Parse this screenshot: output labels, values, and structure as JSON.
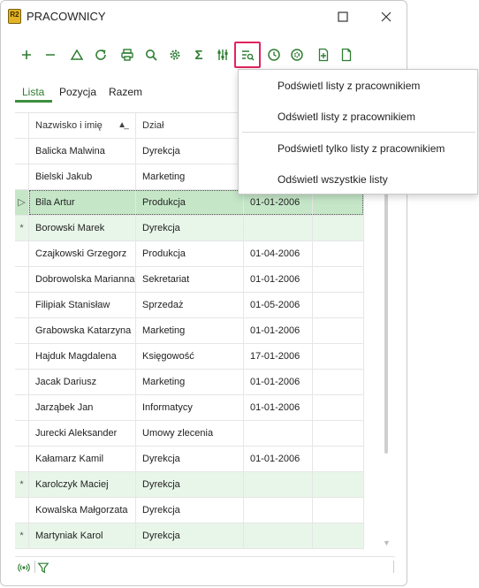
{
  "window": {
    "title": "PRACOWNICY",
    "logo_text": "R2",
    "maximize_icon": "square-icon",
    "close_icon": "close-icon"
  },
  "toolbar": {
    "buttons": [
      {
        "name": "add",
        "icon": "plus-icon"
      },
      {
        "name": "remove",
        "icon": "minus-icon"
      },
      {
        "name": "up",
        "icon": "triangle-icon"
      },
      {
        "name": "refresh",
        "icon": "refresh-icon"
      },
      {
        "name": "print",
        "icon": "printer-icon"
      },
      {
        "name": "search",
        "icon": "magnifier-icon"
      },
      {
        "name": "settings",
        "icon": "gear-icon"
      },
      {
        "name": "sum",
        "icon": "sigma-icon",
        "glyph": "Σ"
      },
      {
        "name": "filters",
        "icon": "sliders-icon"
      },
      {
        "name": "highlight-list",
        "icon": "list-search-icon",
        "active": true
      },
      {
        "name": "history",
        "icon": "clock-icon"
      },
      {
        "name": "config",
        "icon": "cog-badge-icon"
      },
      {
        "name": "new-document",
        "icon": "doc-plus-icon"
      },
      {
        "name": "document",
        "icon": "document-icon"
      }
    ]
  },
  "tabs": [
    "Lista",
    "Pozycja",
    "Razem"
  ],
  "table": {
    "columns": [
      "Nazwisko i imię",
      "Dział",
      "",
      ""
    ],
    "rows": [
      {
        "marker": "",
        "name": "Balicka Malwina",
        "dept": "Dyrekcja",
        "date": "",
        "style": "plain"
      },
      {
        "marker": "",
        "name": "Bielski Jakub",
        "dept": "Marketing",
        "date": "",
        "style": "plain"
      },
      {
        "marker": "▷",
        "name": "Bila Artur",
        "dept": "Produkcja",
        "date": "01-01-2006",
        "style": "selected"
      },
      {
        "marker": "*",
        "name": "Borowski Marek",
        "dept": "Dyrekcja",
        "date": "",
        "style": "green"
      },
      {
        "marker": "",
        "name": "Czajkowski Grzegorz",
        "dept": "Produkcja",
        "date": "01-04-2006",
        "style": "plain"
      },
      {
        "marker": "",
        "name": "Dobrowolska Marianna",
        "dept": "Sekretariat",
        "date": "01-01-2006",
        "style": "plain"
      },
      {
        "marker": "",
        "name": "Filipiak Stanisław",
        "dept": "Sprzedaż",
        "date": "01-05-2006",
        "style": "plain"
      },
      {
        "marker": "",
        "name": "Grabowska Katarzyna",
        "dept": "Marketing",
        "date": "01-01-2006",
        "style": "plain"
      },
      {
        "marker": "",
        "name": "Hajduk Magdalena",
        "dept": "Księgowość",
        "date": "17-01-2006",
        "style": "plain"
      },
      {
        "marker": "",
        "name": "Jacak Dariusz",
        "dept": "Marketing",
        "date": "01-01-2006",
        "style": "plain"
      },
      {
        "marker": "",
        "name": "Jarząbek Jan",
        "dept": "Informatycy",
        "date": "01-01-2006",
        "style": "plain"
      },
      {
        "marker": "",
        "name": "Jurecki Aleksander",
        "dept": "Umowy zlecenia",
        "date": "",
        "style": "plain"
      },
      {
        "marker": "",
        "name": "Kałamarz Kamil",
        "dept": "Dyrekcja",
        "date": "01-01-2006",
        "style": "plain"
      },
      {
        "marker": "*",
        "name": "Karolczyk Maciej",
        "dept": "Dyrekcja",
        "date": "",
        "style": "green"
      },
      {
        "marker": "",
        "name": "Kowalska Małgorzata",
        "dept": "Dyrekcja",
        "date": "",
        "style": "plain"
      },
      {
        "marker": "*",
        "name": "Martyniak Karol",
        "dept": "Dyrekcja",
        "date": "",
        "style": "green"
      }
    ]
  },
  "menu": {
    "items": [
      "Podświetl listy z pracownikiem",
      "Odświetl listy z pracownikiem",
      "Podświetl tylko listy z pracownikiem",
      "Odświetl wszystkie listy"
    ]
  },
  "statusbar": {
    "icons": [
      "radio-signal-icon",
      "filter-icon"
    ]
  },
  "colors": {
    "accent_green": "#3c8f3f",
    "highlight_row": "#e8f6e9",
    "selected_row": "#c5e7c8",
    "active_button_border": "#e0245e"
  }
}
